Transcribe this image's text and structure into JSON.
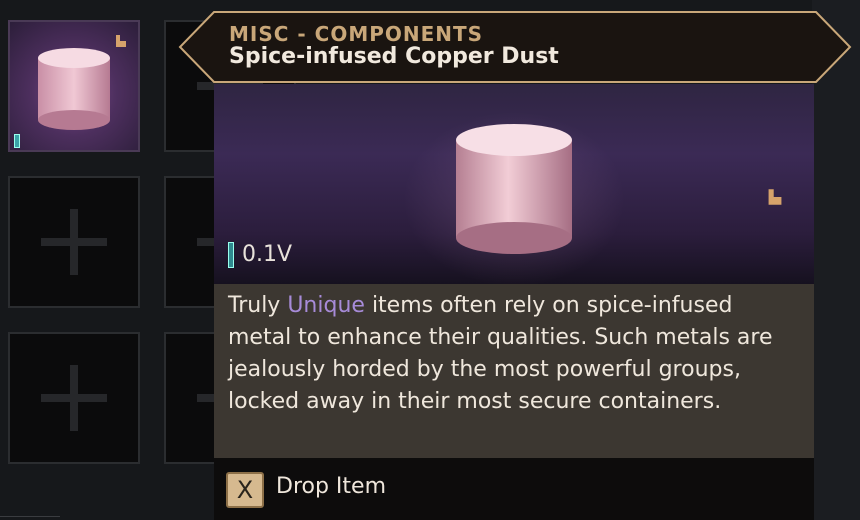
{
  "inventory": {
    "slots": [
      {
        "state": "filled"
      },
      {
        "state": "empty"
      },
      {
        "state": "empty"
      },
      {
        "state": "empty"
      },
      {
        "state": "empty"
      },
      {
        "state": "empty"
      }
    ]
  },
  "tooltip": {
    "category": "MISC - COMPONENTS",
    "title": "Spice-infused Copper Dust",
    "weight": "0.1V",
    "description": {
      "prefix": "Truly",
      "keyword": "Unique",
      "suffix": "items often rely on spice-infused metal to enhance their qualities. Such metals are jealously horded by the most powerful groups, locked away in their most secure containers."
    },
    "action": {
      "key": "X",
      "label": "Drop Item"
    }
  },
  "colors": {
    "header_gold": "#c9a779",
    "keyword_purple": "#a78bd8",
    "rarity_teal": "#2f8a8f"
  }
}
